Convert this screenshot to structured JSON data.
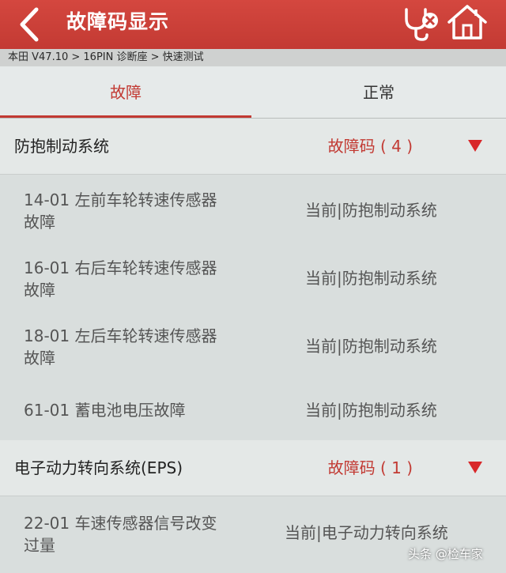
{
  "header": {
    "title": "故障码显示"
  },
  "breadcrumb": "本田 V47.10 > 16PIN 诊断座 > 快速测试",
  "tabs": [
    {
      "label": "故障",
      "active": true
    },
    {
      "label": "正常",
      "active": false
    }
  ],
  "systems": [
    {
      "name": "防抱制动系统",
      "count_label": "故障码 ( 4 )",
      "faults": [
        {
          "code_line1": "14-01 左前车轮转速传感器",
          "code_line2": "故障",
          "status": "当前|防抱制动系统"
        },
        {
          "code_line1": "16-01 右后车轮转速传感器",
          "code_line2": "故障",
          "status": "当前|防抱制动系统"
        },
        {
          "code_line1": "18-01 左后车轮转速传感器",
          "code_line2": "故障",
          "status": "当前|防抱制动系统"
        },
        {
          "code_line1": "61-01 蓄电池电压故障",
          "status": "当前|防抱制动系统"
        }
      ]
    },
    {
      "name": "电子动力转向系统(EPS)",
      "count_label": "故障码 ( 1 )",
      "faults": [
        {
          "code_line1": "22-01 车速传感器信号改变",
          "code_line2": "过量",
          "status": "当前|电子动力转向系统"
        }
      ]
    }
  ],
  "watermark": "头条 @检车家",
  "icons": {
    "back": "back-arrow-icon",
    "diagnostic": "stethoscope-clear-icon",
    "home": "home-icon",
    "expand": "triangle-down-icon"
  },
  "colors": {
    "header": "#c9403a",
    "accent": "#c23a33",
    "arrow": "#d8282a"
  }
}
